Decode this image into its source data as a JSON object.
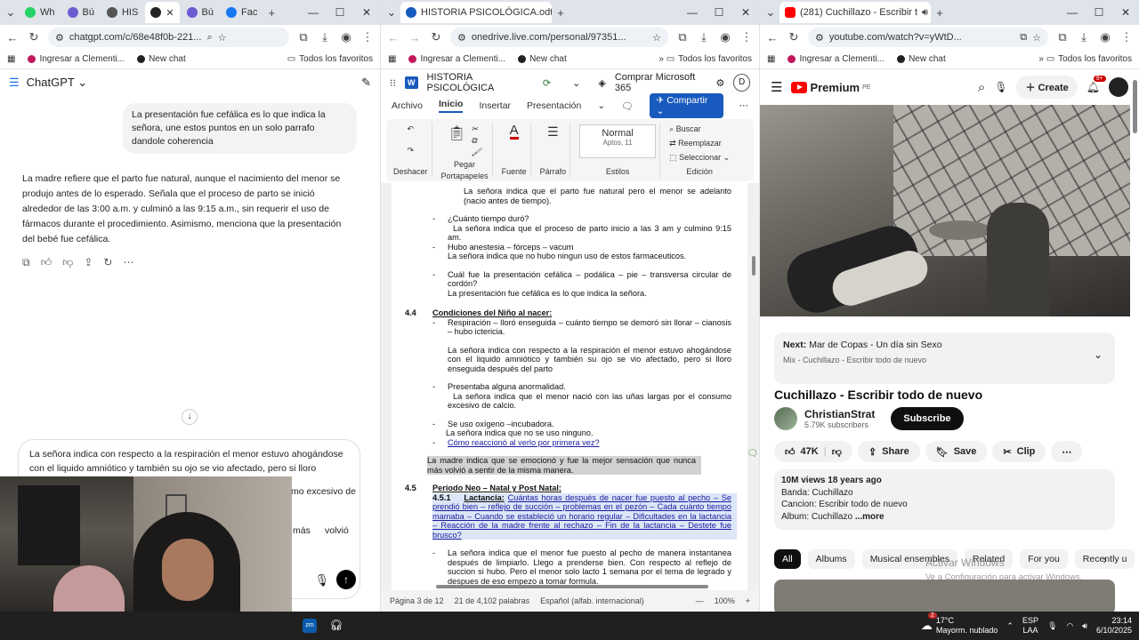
{
  "chatgpt": {
    "tabs": [
      {
        "label": "Wh",
        "color": "#25d366"
      },
      {
        "label": "Bú",
        "color": "#6d5bd0"
      },
      {
        "label": "HIS",
        "color": "#555555"
      },
      {
        "label": "Bú",
        "color": "#6d5bd0"
      },
      {
        "label": "Fac",
        "color": "#1877f2"
      }
    ],
    "url": "chatgpt.com/c/68e48f0b-221...",
    "bookmarks": [
      "Ingresar a Clementi...",
      "New chat",
      "Todos los favoritos"
    ],
    "title": "ChatGPT",
    "user_bubble": "La presentación fue cefálica es lo que indica la señora, une estos puntos en un solo parrafo dandole coherencia",
    "response": "La madre refiere que el parto fue natural, aunque el nacimiento del menor se produjo antes de lo esperado. Señala que el proceso de parto se inició alrededor de las 3:00 a.m. y culminó a las 9:15 a.m., sin requerir el uso de fármacos durante el procedimiento. Asimismo, menciona que la presentación del bebé fue cefálica.",
    "input_text": "La señora indica con respecto a la respiración el menor estuvo ahogándose con el liquido amniótico y también su ojo se vio afectado, pero si lloro enseguida después",
    "input_line2": "mo excesivo de",
    "input_line3a": "más",
    "input_line3b": "volvió"
  },
  "word": {
    "tab_label": "HISTORIA PSICOLÓGICA.odt",
    "url": "onedrive.live.com/personal/97351...",
    "bookmarks": [
      "Ingresar a Clementi...",
      "New chat",
      "Todos los favoritos"
    ],
    "doc_title": "HISTORIA PSICOLÓGICA",
    "buy": "Comprar Microsoft 365",
    "avatar": "D",
    "menu": [
      "Archivo",
      "Inicio",
      "Insertar",
      "Presentación"
    ],
    "share": "Compartir",
    "ribbon": {
      "deshacer": "Deshacer",
      "pegar": "Pegar",
      "portapapeles": "Portapapeles",
      "fuente": "Fuente",
      "parrafo": "Párrafo",
      "style_name": "Normal",
      "style_font": "Aptos, 11",
      "estilos": "Estilos",
      "buscar": "Buscar",
      "reemplazar": "Reemplazar",
      "seleccionar": "Seleccionar",
      "edicion": "Edición"
    },
    "status": {
      "page": "Página 3 de 12",
      "words": "21 de 4,102 palabras",
      "lang": "Español (alfab. internacional)",
      "zoom": "100%"
    }
  },
  "doc": {
    "l1": "La señora indica que el parto fue natural pero el menor se adelanto (nacio antes de tiempo).",
    "q1": "¿Cuánto tiempo duró?",
    "a1": "La señora indica que el proceso de parto inicio a las 3 am y culmino 9:15 am.",
    "q2": "Hubo anestesia – fórceps – vacum",
    "a2": "La señora indica que no hubo ningun uso de estos farmaceuticos.",
    "q3": "Cuál fue la presentación cefálica – podálica – pie – transversa circular de cordón?",
    "a3": "La presentación fue cefálica es lo que indica la señora.",
    "h44num": "4.4",
    "h44": "Condiciones del Niño al nacer:",
    "q4": "Respiración – lloró enseguida – cuánto tiempo se demoró sin llorar – cianosis – hubo ictericia.",
    "a4": "La señora indica con respecto a la respiración el menor estuvo ahogándose con el liquido amniótico y también su ojo se vio afectado, pero si lloro enseguida después del parto",
    "q5": "Presentaba alguna anormalidad.",
    "a5": "La señora indica que el menor nació con las uñas largas por el consumo excesivo de calcio.",
    "q6": "Se uso oxígeno –incubadora.",
    "a6": "La señora indica que no se uso ninguno.",
    "q7": "Cómo reaccionó al verlo por primera vez?",
    "hl": "La madre indica que se emocionó y fue la mejor sensación que nunca más volvió a sentir de la misma manera.",
    "h45num": "4.5",
    "h45": "Periodo Neo – Natal y Post Natal:",
    "h451num": "4.5.1",
    "h451": "Lactancia:",
    "h451text": "Cuántas horas después de nacer fue puesto al pecho – Se prendió bien – reflejo de succión – problemas en el pezón – Cada cuánto tiempo mamaba – Cuando se estableció un horario regular – Dificultades en la lactancia – Reacción de la madre frente al rechazo – Fin de la lactancia – Destete fue brusco?",
    "a8": "La señora indica que el menor fue puesto al pecho de manera instantanea después de limpiarlo. Llego a prenderse bien. Con respecto al reflejo de succion si hubo. Pero el menor solo lacto 1 semana por el tema de legrado y despues de eso empezo a tomar formula."
  },
  "youtube": {
    "tab_label": "(281) Cuchillazo - Escribir t",
    "url": "youtube.com/watch?v=yWtD...",
    "bookmarks": [
      "Ingresar a Clementi...",
      "New chat",
      "Todos los favoritos"
    ],
    "logo": "Premium",
    "logo_sup": "PE",
    "create": "Create",
    "notif": "9+",
    "next_label": "Next:",
    "next_title": "Mar de Copas - Un día sin Sexo",
    "next_sub": "Mix - Cuchillazo - Escribir todo de nuevo",
    "title": "Cuchillazo - Escribir todo de nuevo",
    "channel": "ChristianStrat",
    "subs": "5.79K subscribers",
    "subscribe": "Subscribe",
    "likes": "47K",
    "share": "Share",
    "save": "Save",
    "clip": "Clip",
    "views": "10M views  18 years ago",
    "desc1": "Banda: Cuchillazo",
    "desc2": "Cancion: Escribir todo de nuevo",
    "desc3": "Album: Cuchillazo",
    "more": "...more",
    "chips": [
      "All",
      "Albums",
      "Musical ensembles",
      "Related",
      "For you",
      "Recently u"
    ],
    "wm1": "Activar Windows",
    "wm2": "Ve a Configuración para activar Windows."
  },
  "taskbar": {
    "temp": "17°C",
    "weather": "Mayorm. nublado",
    "weather_badge": "2",
    "lang1": "ESP",
    "lang2": "LAA",
    "time": "23:14",
    "date": "6/10/2025"
  }
}
